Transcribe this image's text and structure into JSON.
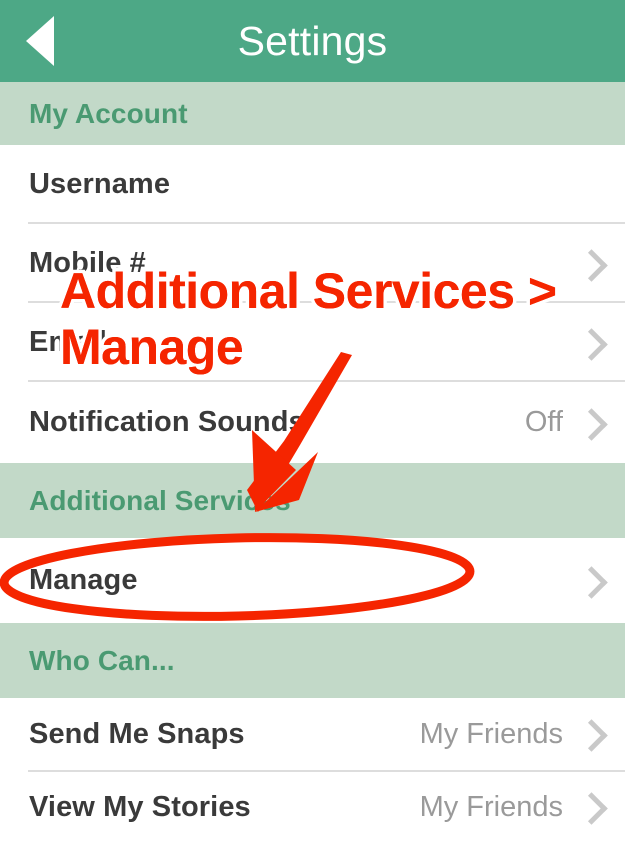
{
  "navbar": {
    "title": "Settings",
    "back_icon": "back-triangle-icon",
    "bg_color": "#4DA886"
  },
  "theme": {
    "header_green": "#4DA886",
    "band_green": "#C2D9C8",
    "band_text_green": "#4A9A72",
    "row_label": "#3A3A3A",
    "row_value": "#9A9A9A",
    "chevron": "#C9C9C9",
    "annotation_red": "#F52500"
  },
  "sections": [
    {
      "id": "my-account",
      "title": "My Account",
      "rows": [
        {
          "id": "username",
          "label": "Username",
          "value": "",
          "redacted": true,
          "chevron": false
        },
        {
          "id": "mobile-number",
          "label": "Mobile #",
          "value": "",
          "redacted": true,
          "chevron": true
        },
        {
          "id": "email",
          "label": "Email",
          "value": "",
          "redacted": true,
          "chevron": true
        },
        {
          "id": "notification-sounds",
          "label": "Notification Sounds",
          "value": "Off",
          "redacted": false,
          "chevron": true
        }
      ]
    },
    {
      "id": "additional-services",
      "title": "Additional Services",
      "rows": [
        {
          "id": "manage",
          "label": "Manage",
          "value": "",
          "redacted": false,
          "chevron": true
        }
      ]
    },
    {
      "id": "who-can",
      "title": "Who Can...",
      "rows": [
        {
          "id": "send-me-snaps",
          "label": "Send Me Snaps",
          "value": "My Friends",
          "redacted": false,
          "chevron": true
        },
        {
          "id": "view-my-stories",
          "label": "View My Stories",
          "value": "My Friends",
          "redacted": false,
          "chevron": true
        }
      ]
    }
  ],
  "annotation": {
    "line1": "Additional Services >",
    "line2": "Manage",
    "color": "#F52500",
    "arrow": "red-arrow-pointing-to-additional-services",
    "highlight": "red-ellipse-around-manage-row"
  }
}
